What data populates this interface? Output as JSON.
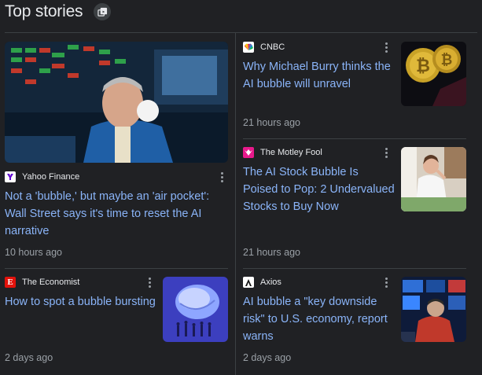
{
  "header": {
    "title": "Top stories",
    "icon": "collection-icon"
  },
  "stories": [
    {
      "source": "Yahoo Finance",
      "favicon_color": "#6001d2",
      "headline": "Not a 'bubble,' but maybe an 'air pocket': Wall Street says it's time to reset the AI narrative",
      "time": "10 hours ago",
      "image": "trader-bubble-gum-photo"
    },
    {
      "source": "CNBC",
      "favicon_color": "#ffffff",
      "headline": "Why Michael Burry thinks the AI bubble will unravel",
      "time": "21 hours ago",
      "image": "bitcoin-coins-photo"
    },
    {
      "source": "The Motley Fool",
      "favicon_color": "#e8198b",
      "headline": "The AI Stock Bubble Is Poised to Pop: 2 Undervalued Stocks to Buy Now",
      "time": "21 hours ago",
      "image": "stressed-woman-photo"
    },
    {
      "source": "The Economist",
      "favicon_color": "#e3120b",
      "headline": "How to spot a bubble bursting",
      "time": "2 days ago",
      "image": "bubble-illustration"
    },
    {
      "source": "Axios",
      "favicon_color": "#ffffff",
      "headline": "AI bubble a \"key downside risk\" to U.S. economy, report warns",
      "time": "2 days ago",
      "image": "trader-screens-photo"
    }
  ]
}
